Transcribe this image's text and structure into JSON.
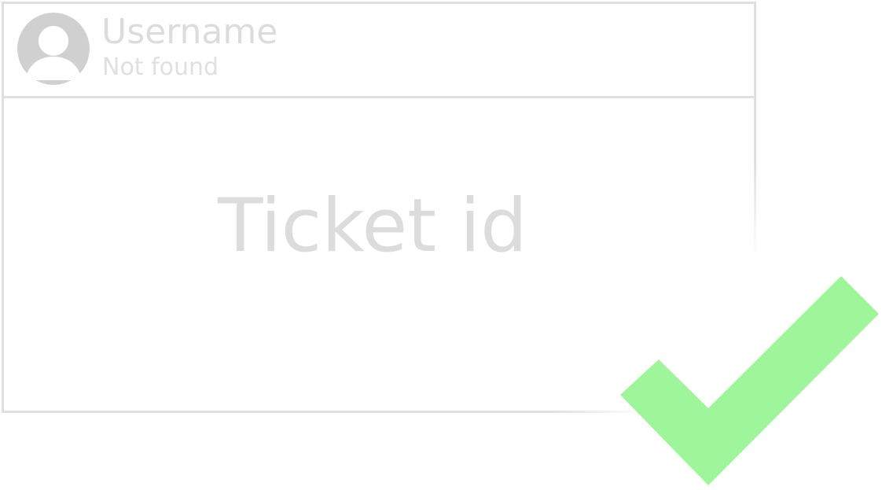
{
  "card": {
    "username": "Username",
    "status": "Not found",
    "ticket_label": "Ticket id"
  },
  "icons": {
    "avatar": "user-avatar-icon",
    "confirm": "checkmark-icon"
  },
  "colors": {
    "border": "#e0e0e0",
    "text_muted": "#dcdcdc",
    "avatar": "#d0d0d0",
    "check": "#9ef59a"
  }
}
